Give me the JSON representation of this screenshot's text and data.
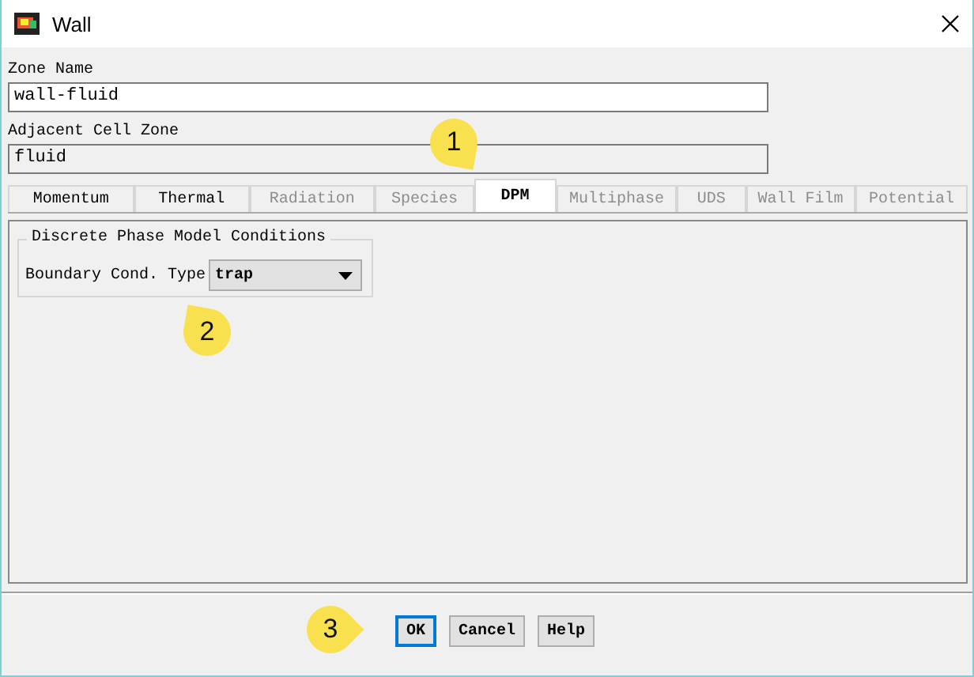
{
  "window": {
    "title": "Wall"
  },
  "zone_name": {
    "label": "Zone Name",
    "value": "wall-fluid"
  },
  "adjacent_cell_zone": {
    "label": "Adjacent Cell Zone",
    "value": "fluid"
  },
  "tabs": [
    {
      "label": "Momentum",
      "selected": false,
      "disabled": false
    },
    {
      "label": "Thermal",
      "selected": false,
      "disabled": false
    },
    {
      "label": "Radiation",
      "selected": false,
      "disabled": true
    },
    {
      "label": "Species",
      "selected": false,
      "disabled": true
    },
    {
      "label": "DPM",
      "selected": true,
      "disabled": false
    },
    {
      "label": "Multiphase",
      "selected": false,
      "disabled": true
    },
    {
      "label": "UDS",
      "selected": false,
      "disabled": true
    },
    {
      "label": "Wall Film",
      "selected": false,
      "disabled": true
    },
    {
      "label": "Potential",
      "selected": false,
      "disabled": true
    }
  ],
  "dpm_group": {
    "title": "Discrete Phase Model Conditions",
    "field_label": "Boundary Cond. Type",
    "value": "trap"
  },
  "buttons": [
    {
      "label": "OK",
      "focused": true
    },
    {
      "label": "Cancel",
      "focused": false
    },
    {
      "label": "Help",
      "focused": false
    }
  ],
  "callouts": [
    {
      "label": "1"
    },
    {
      "label": "2"
    },
    {
      "label": "3"
    }
  ]
}
